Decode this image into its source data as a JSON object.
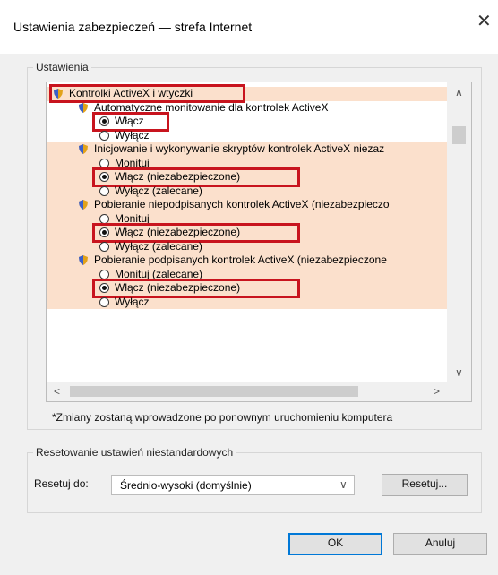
{
  "window": {
    "title": "Ustawienia zabezpieczeń — strefa Internet",
    "close_glyph": "✕"
  },
  "settings_group": {
    "label": "Ustawienia"
  },
  "settings_list": {
    "rows": [
      {
        "kind": "category",
        "icon": "settings-shield-icon",
        "text": "Kontrolki ActiveX i wtyczki"
      },
      {
        "kind": "setting",
        "icon": "settings-shield-icon",
        "text": "Automatyczne monitowanie dla kontrolek ActiveX"
      },
      {
        "kind": "option",
        "selected": true,
        "text": "Włącz"
      },
      {
        "kind": "option",
        "selected": false,
        "text": "Wyłącz"
      },
      {
        "kind": "setting",
        "icon": "settings-shield-icon",
        "text": "Inicjowanie i wykonywanie skryptów kontrolek ActiveX niezaz"
      },
      {
        "kind": "option",
        "selected": false,
        "text": "Monituj"
      },
      {
        "kind": "option",
        "selected": true,
        "text": "Włącz (niezabezpieczone)"
      },
      {
        "kind": "option",
        "selected": false,
        "text": "Wyłącz (zalecane)"
      },
      {
        "kind": "setting",
        "icon": "settings-shield-icon",
        "text": "Pobieranie niepodpisanych kontrolek ActiveX (niezabezpieczo"
      },
      {
        "kind": "option",
        "selected": false,
        "text": "Monituj"
      },
      {
        "kind": "option",
        "selected": true,
        "text": "Włącz (niezabezpieczone)"
      },
      {
        "kind": "option",
        "selected": false,
        "text": "Wyłącz (zalecane)"
      },
      {
        "kind": "setting",
        "icon": "settings-shield-icon",
        "text": "Pobieranie podpisanych kontrolek ActiveX (niezabezpieczone"
      },
      {
        "kind": "option",
        "selected": false,
        "text": "Monituj (zalecane)"
      },
      {
        "kind": "option",
        "selected": true,
        "text": "Włącz (niezabezpieczone)"
      },
      {
        "kind": "option",
        "selected": false,
        "text": "Wyłącz"
      }
    ],
    "scroll_up_glyph": "∧",
    "scroll_down_glyph": "∨",
    "scroll_left_glyph": "<",
    "scroll_right_glyph": ">"
  },
  "restart_note": "*Zmiany zostaną wprowadzone po ponownym uruchomieniu komputera",
  "reset_group": {
    "label": "Resetowanie ustawień niestandardowych",
    "reset_to_label": "Resetuj do:",
    "selected_level": "Średnio-wysoki (domyślnie)",
    "chevron_glyph": "∨",
    "reset_button": "Resetuj..."
  },
  "footer": {
    "ok_button": "OK",
    "cancel_button": "Anuluj"
  },
  "colors": {
    "highlight_box": "#c8141e",
    "row_shade": "#fbe0cc"
  }
}
